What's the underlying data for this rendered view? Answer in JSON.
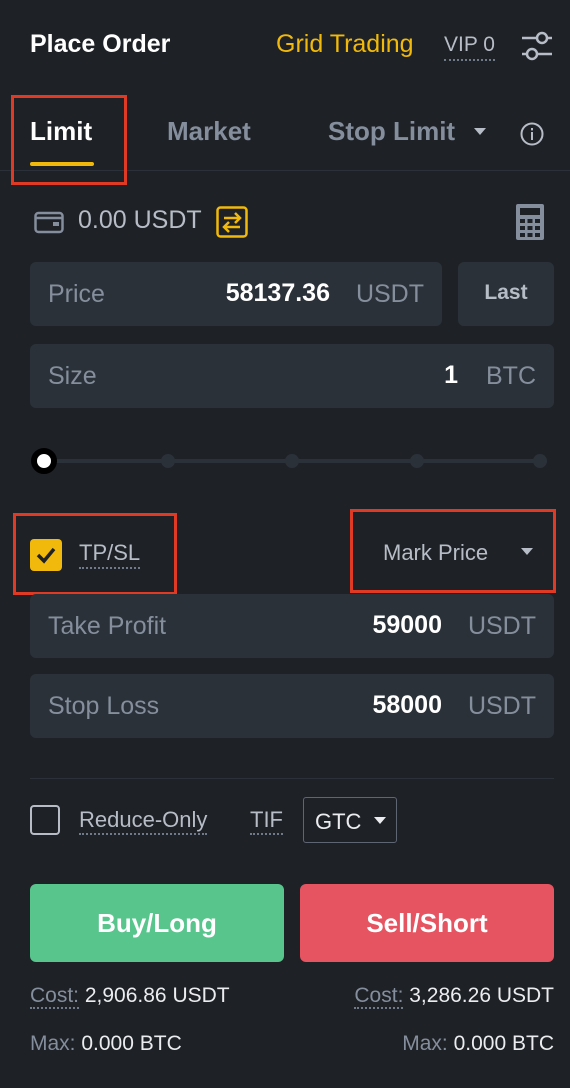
{
  "header": {
    "title": "Place Order",
    "grid_trading": "Grid Trading",
    "vip": "VIP 0"
  },
  "tabs": [
    {
      "label": "Limit",
      "active": true
    },
    {
      "label": "Market",
      "active": false
    },
    {
      "label": "Stop Limit",
      "active": false
    }
  ],
  "balance": {
    "value": "0.00 USDT"
  },
  "price_field": {
    "label": "Price",
    "value": "58137.36",
    "unit": "USDT"
  },
  "last_button": {
    "label": "Last"
  },
  "size_field": {
    "label": "Size",
    "value": "1",
    "unit": "BTC"
  },
  "slider": {
    "value_fraction": 0
  },
  "tpsl": {
    "checked": true,
    "label": "TP/SL",
    "trigger_type": "Mark Price"
  },
  "take_profit": {
    "label": "Take Profit",
    "value": "59000",
    "unit": "USDT"
  },
  "stop_loss": {
    "label": "Stop Loss",
    "value": "58000",
    "unit": "USDT"
  },
  "options": {
    "reduce_only_label": "Reduce-Only",
    "reduce_only_checked": false,
    "tif_label": "TIF",
    "tif_value": "GTC"
  },
  "actions": {
    "buy_label": "Buy/Long",
    "sell_label": "Sell/Short"
  },
  "summary": {
    "cost_label": "Cost:",
    "buy_cost": "2,906.86 USDT",
    "sell_cost": "3,286.26 USDT",
    "max_label": "Max:",
    "buy_max": "0.000 BTC",
    "sell_max": "0.000 BTC"
  },
  "colors": {
    "accent": "#f0b90b",
    "buy": "#58c58d",
    "sell": "#e55460",
    "highlight": "#e03a24"
  }
}
